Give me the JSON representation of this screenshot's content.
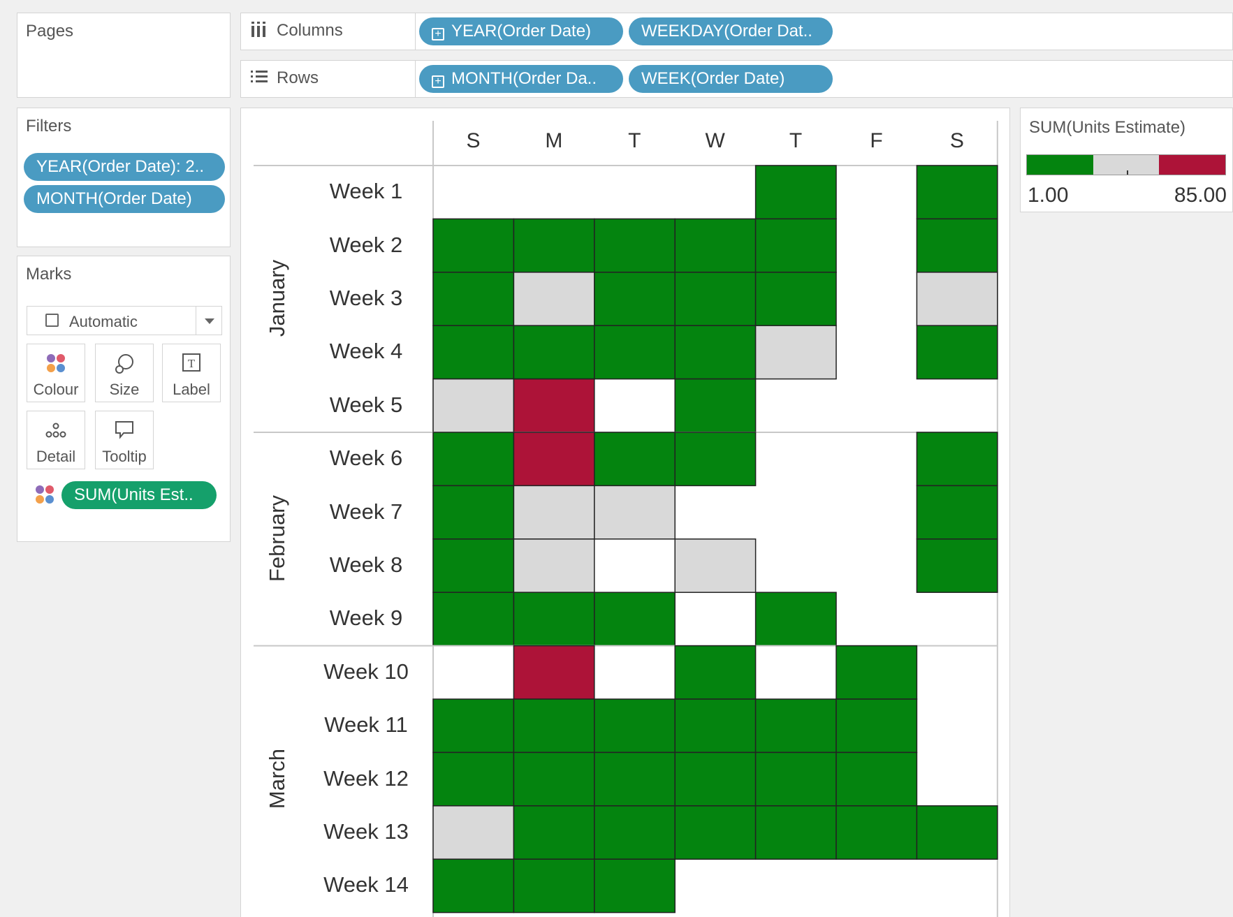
{
  "pages": {
    "title": "Pages"
  },
  "filters": {
    "title": "Filters",
    "pills": [
      "YEAR(Order Date): 2..",
      "MONTH(Order Date)"
    ]
  },
  "marks": {
    "title": "Marks",
    "mark_type": "Automatic",
    "buttons": [
      "Colour",
      "Size",
      "Label",
      "Detail",
      "Tooltip"
    ],
    "colour_pill": "SUM(Units Est.."
  },
  "columns": {
    "label": "Columns",
    "pills": [
      "YEAR(Order Date)",
      "WEEKDAY(Order Dat.."
    ]
  },
  "rows": {
    "label": "Rows",
    "pills": [
      "MONTH(Order Da..",
      "WEEK(Order Date)"
    ]
  },
  "legend": {
    "title": "SUM(Units Estimate)",
    "min": "1.00",
    "max": "85.00",
    "colors": [
      "#04840f",
      "#d9d9d9",
      "#ad1338"
    ]
  },
  "chart_data": {
    "type": "heatmap",
    "x_categories": [
      "S",
      "M",
      "T",
      "W",
      "T",
      "F",
      "S"
    ],
    "months": [
      {
        "name": "January",
        "weeks": [
          "Week 1",
          "Week 2",
          "Week 3",
          "Week 4",
          "Week 5"
        ]
      },
      {
        "name": "February",
        "weeks": [
          "Week 6",
          "Week 7",
          "Week 8",
          "Week 9"
        ]
      },
      {
        "name": "March",
        "weeks": [
          "Week 10",
          "Week 11",
          "Week 12",
          "Week 13",
          "Week 14"
        ]
      }
    ],
    "legend_key": {
      "g": "low",
      "l": "mid",
      "r": "high",
      "0": "no data"
    },
    "grid": [
      [
        "0",
        "0",
        "0",
        "0",
        "g",
        "0",
        "g"
      ],
      [
        "g",
        "g",
        "g",
        "g",
        "g",
        "0",
        "g"
      ],
      [
        "g",
        "l",
        "g",
        "g",
        "g",
        "0",
        "l"
      ],
      [
        "g",
        "g",
        "g",
        "g",
        "l",
        "0",
        "g"
      ],
      [
        "l",
        "r",
        "0",
        "g",
        "0",
        "0",
        "0"
      ],
      [
        "g",
        "r",
        "g",
        "g",
        "0",
        "0",
        "g"
      ],
      [
        "g",
        "l",
        "l",
        "0",
        "0",
        "0",
        "g"
      ],
      [
        "g",
        "l",
        "0",
        "l",
        "0",
        "0",
        "g"
      ],
      [
        "g",
        "g",
        "g",
        "0",
        "g",
        "0",
        "0"
      ],
      [
        "0",
        "r",
        "0",
        "g",
        "0",
        "g",
        "0"
      ],
      [
        "g",
        "g",
        "g",
        "g",
        "g",
        "g",
        "0"
      ],
      [
        "g",
        "g",
        "g",
        "g",
        "g",
        "g",
        "0"
      ],
      [
        "l",
        "g",
        "g",
        "g",
        "g",
        "g",
        "g"
      ],
      [
        "g",
        "g",
        "g",
        "0",
        "0",
        "0",
        "0"
      ]
    ]
  }
}
